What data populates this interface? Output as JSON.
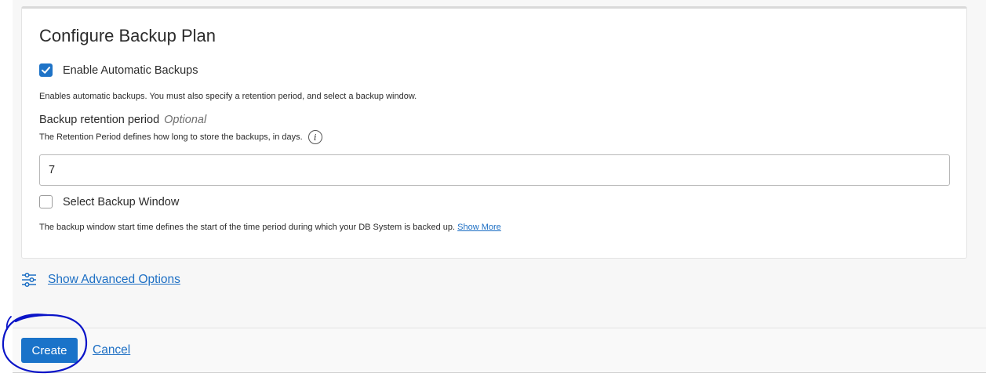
{
  "card": {
    "title": "Configure Backup Plan",
    "enable_backups": {
      "label": "Enable Automatic Backups",
      "checked": true,
      "help": "Enables automatic backups. You must also specify a retention period, and select a backup window."
    },
    "retention": {
      "label": "Backup retention period",
      "optional": "Optional",
      "help": "The Retention Period defines how long to store the backups, in days.",
      "value": "7"
    },
    "backup_window": {
      "label": "Select Backup Window",
      "checked": false,
      "help": "The backup window start time defines the start of the time period during which your DB System is backed up.",
      "show_more": "Show More"
    }
  },
  "advanced": {
    "label": "Show Advanced Options",
    "icon": "sliders-icon"
  },
  "footer": {
    "create_label": "Create",
    "cancel_label": "Cancel"
  },
  "colors": {
    "accent": "#1a73c9",
    "link": "#1d6fc4",
    "annotation": "#0a14c8"
  }
}
